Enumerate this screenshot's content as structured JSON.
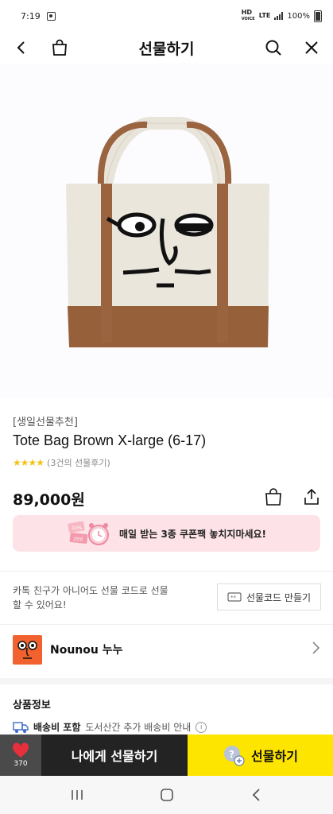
{
  "status_bar": {
    "time": "7:19",
    "net_hd": "HD",
    "net_voice": "VOICE",
    "net_lte": "LTE",
    "battery": "100%"
  },
  "header": {
    "title": "선물하기"
  },
  "product": {
    "tag": "[생일선물추천]",
    "name": "Tote Bag Brown X-large (6-17)",
    "review_text": "(3건의 선물후기)",
    "stars": "★★★★",
    "price": "89,000원"
  },
  "coupon_banner": {
    "text": "매일 받는 3종 쿠폰팩 놓치지마세요!",
    "badge_percent": "10%",
    "badge_won": "2천원"
  },
  "gift_code": {
    "description": "카톡 친구가 아니어도 선물 코드로 선물 할 수 있어요!",
    "button_label": "선물코드 만들기"
  },
  "brand": {
    "name": "Nounou 누누"
  },
  "product_info": {
    "title": "상품정보",
    "shipping_strong": "배송비 포함",
    "shipping_sub": "도서산간 추가 배송비 안내"
  },
  "bottom_bar": {
    "wish_count": "370",
    "gift_to_me_label": "나에게 선물하기",
    "gift_label": "선물하기"
  },
  "colors": {
    "accent_yellow": "#fde500",
    "dark_button": "#232323",
    "heart_red": "#e8303c",
    "star_yellow": "#f2c21b",
    "brand_orange": "#f2622e",
    "banner_pink": "#fde3e7"
  }
}
